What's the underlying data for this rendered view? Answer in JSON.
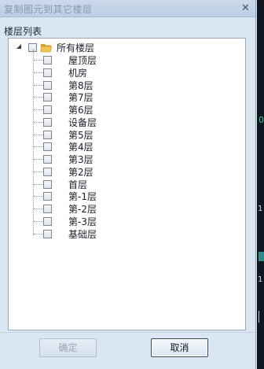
{
  "dialog": {
    "title": "复制图元到其它楼层",
    "close_glyph": "✕",
    "list_label": "楼层列表",
    "tree": {
      "root_label": "所有楼层",
      "items": [
        {
          "label": "屋顶层",
          "checked": false
        },
        {
          "label": "机房",
          "checked": false
        },
        {
          "label": "第8层",
          "checked": false
        },
        {
          "label": "第7层",
          "checked": false
        },
        {
          "label": "第6层",
          "checked": false
        },
        {
          "label": "设备层",
          "checked": false
        },
        {
          "label": "第5层",
          "checked": false
        },
        {
          "label": "第4层",
          "checked": false
        },
        {
          "label": "第3层",
          "checked": false
        },
        {
          "label": "第2层",
          "checked": false
        },
        {
          "label": "首层",
          "checked": false
        },
        {
          "label": "第-1层",
          "checked": false
        },
        {
          "label": "第-2层",
          "checked": false
        },
        {
          "label": "第-3层",
          "checked": false
        },
        {
          "label": "基础层",
          "checked": false
        }
      ]
    },
    "buttons": {
      "ok_label": "确定",
      "ok_enabled": false,
      "cancel_label": "取消"
    }
  },
  "background_right": {
    "marker_1": "1",
    "marker_2": "1"
  },
  "colors": {
    "dialog_bg": "#dbe6f3",
    "panel_bg": "#ffffff",
    "folder": "#e8b23c",
    "side_strip": "#0f1620",
    "side_accent": "#2e8b8b"
  }
}
